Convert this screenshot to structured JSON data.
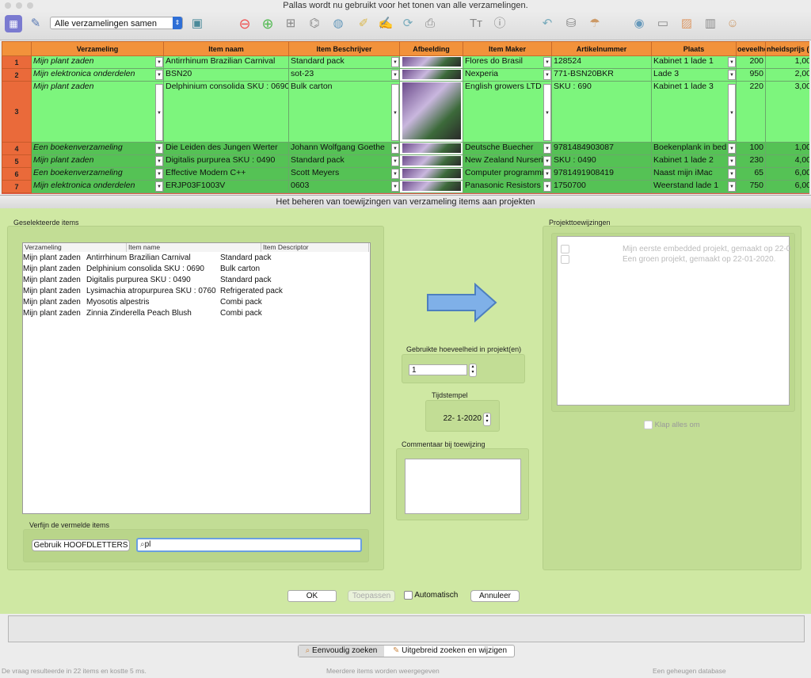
{
  "window": {
    "title": "Pallas wordt nu gebruikt voor het tonen van alle verzamelingen."
  },
  "toolbar": {
    "collection_select": "Alle verzamelingen samen",
    "icons": [
      "app-icon",
      "brush-icon",
      "image-icon",
      "remove-icon",
      "add-icon",
      "add-item-icon",
      "satellite-icon",
      "globe-icon",
      "edit-icon",
      "edit-doc-icon",
      "refresh-icon",
      "print-icon",
      "text-size-icon",
      "info-icon",
      "undo-icon",
      "database-icon",
      "umbrella-icon",
      "web-icon",
      "window-icon",
      "picture-icon",
      "server-icon",
      "person-icon"
    ]
  },
  "grid": {
    "headers": [
      "Verzameling",
      "Item naam",
      "Item Beschrijver",
      "Afbeelding",
      "Item Maker",
      "Artikelnummer",
      "Plaats",
      "Hoeveelheid",
      "Eenheidsprijs"
    ],
    "headers_visible": [
      "Verzameling",
      "Item naam",
      "Item Beschrijver",
      "Afbeelding",
      "Item Maker",
      "Artikelnummer",
      "Plaats",
      "oeveelhe",
      "nheidsprijs (A"
    ],
    "rows": [
      {
        "n": "1",
        "verz": "Mijn plant zaden",
        "naam": "Antirrhinum Brazilian Carnival",
        "beschr": "Standard pack",
        "maker": "Flores do Brasil",
        "art": "128524",
        "plaats": "Kabinet 1 lade 1",
        "hoev": "200",
        "prijs": "1,00",
        "tone": "light"
      },
      {
        "n": "2",
        "verz": "Mijn elektronica onderdelen",
        "naam": "BSN20",
        "beschr": "sot-23",
        "maker": "Nexperia",
        "art": "771-BSN20BKR",
        "plaats": "Lade 3",
        "hoev": "950",
        "prijs": "2,00",
        "tone": "light"
      },
      {
        "n": "3",
        "verz": "Mijn plant zaden",
        "naam": "Delphinium consolida SKU : 0690",
        "beschr": "Bulk carton",
        "maker": "English growers LTD",
        "art": "SKU : 690",
        "plaats": "Kabinet 1 lade 3",
        "hoev": "220",
        "prijs": "3,00",
        "tone": "light"
      },
      {
        "n": "4",
        "verz": "Een boekenverzameling",
        "naam": "Die Leiden des Jungen Werter",
        "beschr": "Johann Wolfgang Goethe",
        "maker": "Deutsche Buecher",
        "art": "9781484903087",
        "plaats": "Boekenplank in bed",
        "hoev": "100",
        "prijs": "1,00",
        "tone": "dark"
      },
      {
        "n": "5",
        "verz": "Mijn plant zaden",
        "naam": "Digitalis purpurea SKU : 0490",
        "beschr": "Standard pack",
        "maker": "New Zealand Nurseri",
        "art": "SKU : 0490",
        "plaats": "Kabinet 1 lade 2",
        "hoev": "230",
        "prijs": "4,00",
        "tone": "dark"
      },
      {
        "n": "6",
        "verz": "Een boekenverzameling",
        "naam": "Effective Modern C++",
        "beschr": "Scott Meyers",
        "maker": "Computer programmi",
        "art": "9781491908419",
        "plaats": "Naast mijn iMac",
        "hoev": "65",
        "prijs": "6,00",
        "tone": "dark"
      },
      {
        "n": "7",
        "verz": "Mijn elektronica onderdelen",
        "naam": "ERJP03F1003V",
        "beschr": "0603",
        "maker": "Panasonic Resistors",
        "art": "1750700",
        "plaats": "Weerstand lade 1",
        "hoev": "750",
        "prijs": "6,00",
        "tone": "dark"
      }
    ]
  },
  "dialog": {
    "title": "Het beheren van toewijzingen van verzameling items aan projekten",
    "selected_group_label": "Geselekteerde items",
    "list_headers": [
      "Verzameling",
      "Item name",
      "Item Descriptor"
    ],
    "selected_items": [
      {
        "verz": "Mijn plant zaden",
        "name": "Antirrhinum Brazilian Carnival",
        "desc": "Standard pack"
      },
      {
        "verz": "Mijn plant zaden",
        "name": "Delphinium consolida SKU : 0690",
        "desc": "Bulk carton"
      },
      {
        "verz": "Mijn plant zaden",
        "name": "Digitalis purpurea SKU : 0490",
        "desc": "Standard pack"
      },
      {
        "verz": "Mijn plant zaden",
        "name": "Lysimachia atropurpurea SKU : 0760",
        "desc": "Refrigerated pack"
      },
      {
        "verz": "Mijn plant zaden",
        "name": "Myosotis alpestris",
        "desc": "Combi pack"
      },
      {
        "verz": "Mijn plant zaden",
        "name": "Zinnia Zinderella Peach Blush",
        "desc": "Combi pack"
      }
    ],
    "refine_label": "Verfijn de vermelde items",
    "uppercase_button": "Gebruik HOOFDLETTERS",
    "search_value": "pl",
    "quantity_label": "Gebruikte hoeveelheid in projekt(en)",
    "quantity_value": "1",
    "timestamp_label": "Tijdstempel",
    "timestamp_value": "22-  1-2020",
    "comment_label": "Commentaar bij toewijzing",
    "projects_label": "Projekttoewijzingen",
    "projects": [
      "Mijn eerste embedded projekt, gemaakt op 22-0",
      "Een groen projekt, gemaakt op 22-01-2020."
    ],
    "collapse_label": "Klap alles om",
    "ok": "OK",
    "apply": "Toepassen",
    "automatic": "Automatisch",
    "cancel": "Annuleer"
  },
  "bottom": {
    "simple_search": "Eenvoudig zoeken",
    "advanced_search": "Uitgebreid zoeken en wijzigen"
  },
  "status": {
    "left": "De vraag resulteerde in 22 items en kostte 5 ms.",
    "center": "Meerdere items worden weergegeven",
    "right": "Een geheugen database"
  }
}
